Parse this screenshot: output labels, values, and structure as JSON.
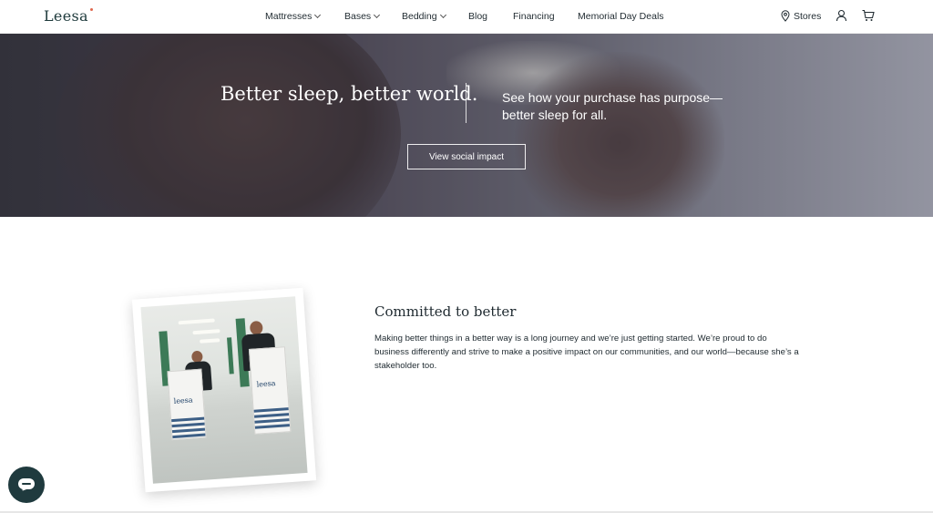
{
  "header": {
    "logo": "Leesa",
    "nav": [
      {
        "label": "Mattresses",
        "has_dropdown": true
      },
      {
        "label": "Bases",
        "has_dropdown": true
      },
      {
        "label": "Bedding",
        "has_dropdown": true
      },
      {
        "label": "Blog",
        "has_dropdown": false
      },
      {
        "label": "Financing",
        "has_dropdown": false
      },
      {
        "label": "Memorial Day Deals",
        "has_dropdown": false
      }
    ],
    "stores_label": "Stores",
    "icons": [
      "location-pin-icon",
      "user-icon",
      "cart-icon"
    ]
  },
  "hero": {
    "title": "Better sleep, better world.",
    "subtitle": "See how your purchase has purpose—better sleep for all.",
    "button_label": "View social impact"
  },
  "section": {
    "title": "Committed to better",
    "body": "Making better things in a better way is a long journey and we’re just getting started. We’re proud to do business differently and strive to make a positive impact on our communities, and our world—because she’s a stakeholder too.",
    "photo_box_logo": "leesa"
  },
  "chat": {
    "icon": "chat-bubble-icon"
  },
  "colors": {
    "brand_dark": "#1f3a3e",
    "text": "#1f2a30",
    "logo_accent": "#e0674d"
  }
}
